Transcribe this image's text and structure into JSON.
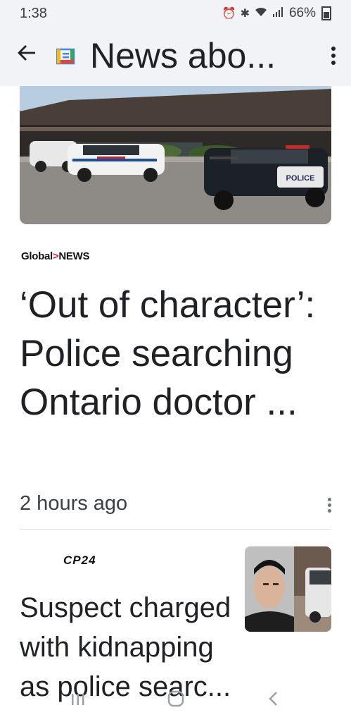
{
  "status_bar": {
    "time": "1:38",
    "battery": "66%"
  },
  "app_bar": {
    "title": "News abo..."
  },
  "articles": [
    {
      "source_text": "Global",
      "source_text_2": "NEWS",
      "headline": "‘Out of character’: Police searching Ontario doctor ...",
      "time": "2 hours ago"
    },
    {
      "source_text": "CP24",
      "headline": "Suspect charged with kidnapping as police searc..."
    }
  ],
  "hero_image": {
    "police_label": "POLICE"
  },
  "colors": {
    "app_bar_bg": "#f1f3f6",
    "global_news_accent": "#e3262b"
  }
}
